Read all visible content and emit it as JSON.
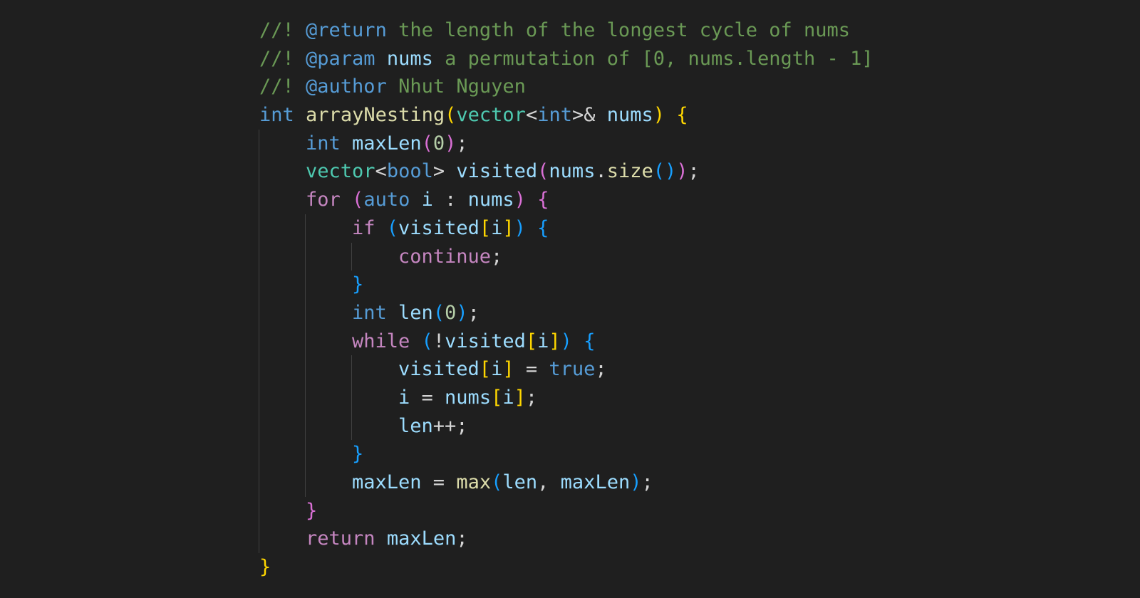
{
  "editor": {
    "theme": "dark",
    "background": "#1f1f1f",
    "colors": {
      "comment": "#6a9955",
      "doc_tag": "#569cd6",
      "keyword_type": "#569cd6",
      "keyword_control": "#c586c0",
      "function": "#dcdcaa",
      "variable": "#9cdcfe",
      "type": "#4ec9b0",
      "number": "#b5cea8",
      "punct": "#d4d4d4",
      "bracket1": "#ffd700",
      "bracket2": "#da70d6",
      "bracket3": "#179fff"
    }
  },
  "code": {
    "language": "cpp",
    "lines": [
      {
        "indent": 0,
        "tokens": [
          {
            "t": "//! ",
            "c": "comment"
          },
          {
            "t": "@return",
            "c": "doc_tag"
          },
          {
            "t": " the length of the longest cycle of nums",
            "c": "comment"
          }
        ]
      },
      {
        "indent": 0,
        "tokens": [
          {
            "t": "//! ",
            "c": "comment"
          },
          {
            "t": "@param",
            "c": "doc_tag"
          },
          {
            "t": " ",
            "c": "comment"
          },
          {
            "t": "nums",
            "c": "variable"
          },
          {
            "t": " a permutation of [0, nums.length - 1]",
            "c": "comment"
          }
        ]
      },
      {
        "indent": 0,
        "tokens": [
          {
            "t": "//! ",
            "c": "comment"
          },
          {
            "t": "@author",
            "c": "doc_tag"
          },
          {
            "t": " Nhut Nguyen",
            "c": "comment"
          }
        ]
      },
      {
        "indent": 0,
        "tokens": [
          {
            "t": "int",
            "c": "keyword_type"
          },
          {
            "t": " ",
            "c": "punct"
          },
          {
            "t": "arrayNesting",
            "c": "function"
          },
          {
            "t": "(",
            "c": "bracket1"
          },
          {
            "t": "vector",
            "c": "type"
          },
          {
            "t": "<",
            "c": "punct"
          },
          {
            "t": "int",
            "c": "keyword_type"
          },
          {
            "t": ">& ",
            "c": "punct"
          },
          {
            "t": "nums",
            "c": "variable"
          },
          {
            "t": ")",
            "c": "bracket1"
          },
          {
            "t": " ",
            "c": "punct"
          },
          {
            "t": "{",
            "c": "bracket1"
          }
        ]
      },
      {
        "indent": 1,
        "tokens": [
          {
            "t": "int",
            "c": "keyword_type"
          },
          {
            "t": " ",
            "c": "punct"
          },
          {
            "t": "maxLen",
            "c": "variable"
          },
          {
            "t": "(",
            "c": "bracket2"
          },
          {
            "t": "0",
            "c": "number"
          },
          {
            "t": ")",
            "c": "bracket2"
          },
          {
            "t": ";",
            "c": "punct"
          }
        ]
      },
      {
        "indent": 1,
        "tokens": [
          {
            "t": "vector",
            "c": "type"
          },
          {
            "t": "<",
            "c": "punct"
          },
          {
            "t": "bool",
            "c": "keyword_type"
          },
          {
            "t": "> ",
            "c": "punct"
          },
          {
            "t": "visited",
            "c": "variable"
          },
          {
            "t": "(",
            "c": "bracket2"
          },
          {
            "t": "nums",
            "c": "variable"
          },
          {
            "t": ".",
            "c": "punct"
          },
          {
            "t": "size",
            "c": "function"
          },
          {
            "t": "()",
            "c": "bracket3"
          },
          {
            "t": ")",
            "c": "bracket2"
          },
          {
            "t": ";",
            "c": "punct"
          }
        ]
      },
      {
        "indent": 1,
        "tokens": [
          {
            "t": "for",
            "c": "keyword_control"
          },
          {
            "t": " ",
            "c": "punct"
          },
          {
            "t": "(",
            "c": "bracket2"
          },
          {
            "t": "auto",
            "c": "keyword_type"
          },
          {
            "t": " ",
            "c": "punct"
          },
          {
            "t": "i",
            "c": "variable"
          },
          {
            "t": " : ",
            "c": "punct"
          },
          {
            "t": "nums",
            "c": "variable"
          },
          {
            "t": ")",
            "c": "bracket2"
          },
          {
            "t": " ",
            "c": "punct"
          },
          {
            "t": "{",
            "c": "bracket2"
          }
        ]
      },
      {
        "indent": 2,
        "tokens": [
          {
            "t": "if",
            "c": "keyword_control"
          },
          {
            "t": " ",
            "c": "punct"
          },
          {
            "t": "(",
            "c": "bracket3"
          },
          {
            "t": "visited",
            "c": "variable"
          },
          {
            "t": "[",
            "c": "bracket1"
          },
          {
            "t": "i",
            "c": "variable"
          },
          {
            "t": "]",
            "c": "bracket1"
          },
          {
            "t": ")",
            "c": "bracket3"
          },
          {
            "t": " ",
            "c": "punct"
          },
          {
            "t": "{",
            "c": "bracket3"
          }
        ]
      },
      {
        "indent": 3,
        "tokens": [
          {
            "t": "continue",
            "c": "keyword_control"
          },
          {
            "t": ";",
            "c": "punct"
          }
        ]
      },
      {
        "indent": 2,
        "tokens": [
          {
            "t": "}",
            "c": "bracket3"
          }
        ]
      },
      {
        "indent": 2,
        "tokens": [
          {
            "t": "int",
            "c": "keyword_type"
          },
          {
            "t": " ",
            "c": "punct"
          },
          {
            "t": "len",
            "c": "variable"
          },
          {
            "t": "(",
            "c": "bracket3"
          },
          {
            "t": "0",
            "c": "number"
          },
          {
            "t": ")",
            "c": "bracket3"
          },
          {
            "t": ";",
            "c": "punct"
          }
        ]
      },
      {
        "indent": 2,
        "tokens": [
          {
            "t": "while",
            "c": "keyword_control"
          },
          {
            "t": " ",
            "c": "punct"
          },
          {
            "t": "(",
            "c": "bracket3"
          },
          {
            "t": "!",
            "c": "punct"
          },
          {
            "t": "visited",
            "c": "variable"
          },
          {
            "t": "[",
            "c": "bracket1"
          },
          {
            "t": "i",
            "c": "variable"
          },
          {
            "t": "]",
            "c": "bracket1"
          },
          {
            "t": ")",
            "c": "bracket3"
          },
          {
            "t": " ",
            "c": "punct"
          },
          {
            "t": "{",
            "c": "bracket3"
          }
        ]
      },
      {
        "indent": 3,
        "tokens": [
          {
            "t": "visited",
            "c": "variable"
          },
          {
            "t": "[",
            "c": "bracket1"
          },
          {
            "t": "i",
            "c": "variable"
          },
          {
            "t": "]",
            "c": "bracket1"
          },
          {
            "t": " = ",
            "c": "punct"
          },
          {
            "t": "true",
            "c": "keyword_type"
          },
          {
            "t": ";",
            "c": "punct"
          }
        ]
      },
      {
        "indent": 3,
        "tokens": [
          {
            "t": "i",
            "c": "variable"
          },
          {
            "t": " = ",
            "c": "punct"
          },
          {
            "t": "nums",
            "c": "variable"
          },
          {
            "t": "[",
            "c": "bracket1"
          },
          {
            "t": "i",
            "c": "variable"
          },
          {
            "t": "]",
            "c": "bracket1"
          },
          {
            "t": ";",
            "c": "punct"
          }
        ]
      },
      {
        "indent": 3,
        "tokens": [
          {
            "t": "len",
            "c": "variable"
          },
          {
            "t": "++;",
            "c": "punct"
          }
        ]
      },
      {
        "indent": 2,
        "tokens": [
          {
            "t": "}",
            "c": "bracket3"
          }
        ]
      },
      {
        "indent": 2,
        "tokens": [
          {
            "t": "maxLen",
            "c": "variable"
          },
          {
            "t": " = ",
            "c": "punct"
          },
          {
            "t": "max",
            "c": "function"
          },
          {
            "t": "(",
            "c": "bracket3"
          },
          {
            "t": "len",
            "c": "variable"
          },
          {
            "t": ", ",
            "c": "punct"
          },
          {
            "t": "maxLen",
            "c": "variable"
          },
          {
            "t": ")",
            "c": "bracket3"
          },
          {
            "t": ";",
            "c": "punct"
          }
        ]
      },
      {
        "indent": 1,
        "tokens": [
          {
            "t": "}",
            "c": "bracket2"
          }
        ]
      },
      {
        "indent": 1,
        "tokens": [
          {
            "t": "return",
            "c": "keyword_control"
          },
          {
            "t": " ",
            "c": "punct"
          },
          {
            "t": "maxLen",
            "c": "variable"
          },
          {
            "t": ";",
            "c": "punct"
          }
        ]
      },
      {
        "indent": 0,
        "tokens": [
          {
            "t": "}",
            "c": "bracket1"
          }
        ]
      }
    ]
  }
}
